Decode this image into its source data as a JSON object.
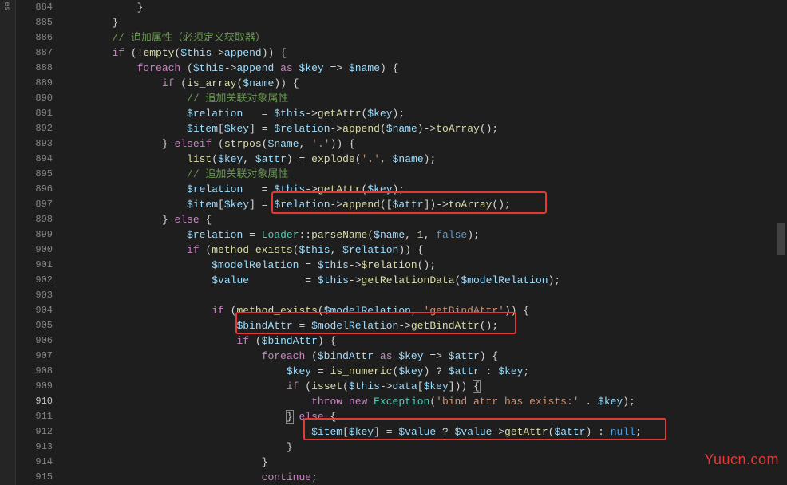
{
  "left_panel_label": "es",
  "line_numbers": [
    884,
    885,
    886,
    887,
    888,
    889,
    890,
    891,
    892,
    893,
    894,
    895,
    896,
    897,
    898,
    899,
    900,
    901,
    902,
    903,
    904,
    905,
    906,
    907,
    908,
    909,
    910,
    911,
    912,
    913,
    914,
    915
  ],
  "active_line": 910,
  "watermark": "Yuucn.com",
  "comments": {
    "append_attr": "// 追加属性（必须定义获取器）",
    "append_relation1": "// 追加关联对象属性",
    "append_relation2": "// 追加关联对象属性"
  },
  "code_tokens": {
    "if": "if",
    "empty": "empty",
    "this": "$this",
    "append": "append",
    "foreach": "foreach",
    "as": "as",
    "key": "$key",
    "name": "$name",
    "is_array": "is_array",
    "relation": "$relation",
    "getAttr": "getAttr",
    "item": "$item",
    "toArray": "toArray",
    "elseif": "elseif",
    "strpos": "strpos",
    "dot": "'.'",
    "list": "list",
    "attr": "$attr",
    "explode": "explode",
    "else": "else",
    "Loader": "Loader",
    "parseName": "parseName",
    "one": "1",
    "false": "false",
    "method_exists": "method_exists",
    "modelRelation": "$modelRelation",
    "value": "$value",
    "getRelationData": "getRelationData",
    "getBindAttr_str": "'getBindAttr'",
    "bindAttr": "$bindAttr",
    "getBindAttr": "getBindAttr",
    "is_numeric": "is_numeric",
    "isset": "isset",
    "data": "data",
    "throw": "throw",
    "new": "new",
    "Exception": "Exception",
    "bind_msg": "'bind attr has exists:'",
    "null": "null",
    "continue": "continue"
  }
}
